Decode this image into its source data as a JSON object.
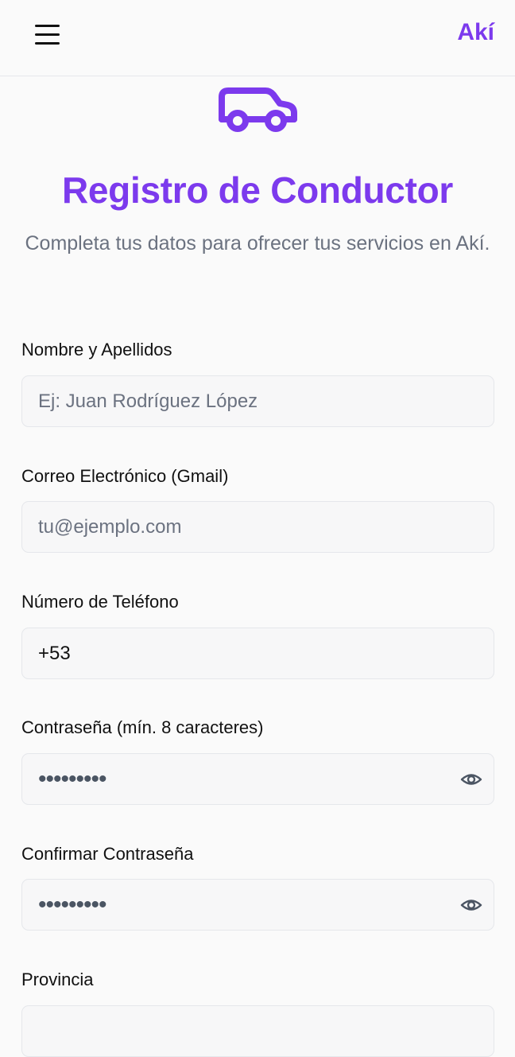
{
  "header": {
    "brand": "Akí",
    "menu_icon": "hamburger-menu-icon"
  },
  "hero": {
    "icon": "car-icon",
    "title": "Registro de Conductor",
    "subtitle": "Completa tus datos para ofrecer tus servicios en Akí."
  },
  "form": {
    "name": {
      "label": "Nombre y Apellidos",
      "placeholder": "Ej: Juan Rodríguez López"
    },
    "email": {
      "label": "Correo Electrónico (Gmail)",
      "placeholder": "tu@ejemplo.com"
    },
    "phone": {
      "label": "Número de Teléfono",
      "value": "+53"
    },
    "password": {
      "label": "Contraseña (mín. 8 caracteres)",
      "value": "•••••••••",
      "toggle_icon": "eye-icon"
    },
    "confirm_password": {
      "label": "Confirmar Contraseña",
      "value": "•••••••••",
      "toggle_icon": "eye-icon"
    },
    "province": {
      "label": "Provincia"
    }
  },
  "colors": {
    "accent": "#7c3aed",
    "muted_text": "#6b7280",
    "border": "#e5e7eb",
    "input_bg": "#f7f7f8"
  }
}
